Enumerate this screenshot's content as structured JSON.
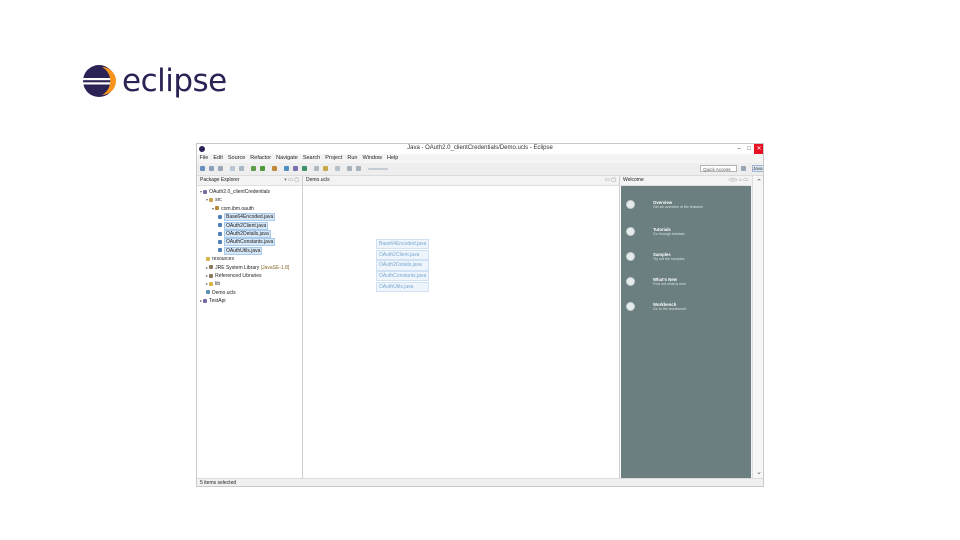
{
  "logo": {
    "text": "eclipse"
  },
  "window": {
    "title": "Java - OAuth2.0_clientCredentials/Demo.ucls - Eclipse",
    "controls": [
      "–",
      "□",
      "✕"
    ]
  },
  "menu": [
    "File",
    "Edit",
    "Source",
    "Refactor",
    "Navigate",
    "Search",
    "Project",
    "Run",
    "Window",
    "Help"
  ],
  "toolbar": {
    "quick_access": "Quick Access",
    "perspective": "Java"
  },
  "package_explorer": {
    "tab_label": "Package Explorer",
    "tree": [
      {
        "label": "OAuth2.0_clientCredentials",
        "level": 0,
        "icon": "project-icon"
      },
      {
        "label": "src",
        "level": 1,
        "icon": "source-folder-icon"
      },
      {
        "label": "com.ibm.oauth",
        "level": 2,
        "icon": "package-icon"
      },
      {
        "label": "Base64Encoded.java",
        "level": 3,
        "icon": "java-file-icon",
        "selected": true
      },
      {
        "label": "OAuth2Client.java",
        "level": 3,
        "icon": "java-file-icon",
        "selected": true
      },
      {
        "label": "OAuth2Details.java",
        "level": 3,
        "icon": "java-file-icon",
        "selected": true
      },
      {
        "label": "OAuthConstants.java",
        "level": 3,
        "icon": "java-file-icon",
        "selected": true
      },
      {
        "label": "OAuthUtils.java",
        "level": 3,
        "icon": "java-file-icon",
        "selected": true
      },
      {
        "label": "resources",
        "level": 1,
        "icon": "folder-icon"
      },
      {
        "label": "JRE System Library",
        "suffix": " [JavaSE-1.8]",
        "level": 1,
        "icon": "library-icon"
      },
      {
        "label": "Referenced Libraries",
        "level": 1,
        "icon": "library-icon"
      },
      {
        "label": "lib",
        "level": 1,
        "icon": "folder-icon"
      },
      {
        "label": "Demo.ucls",
        "level": 1,
        "icon": "ucls-file-icon"
      },
      {
        "label": "TestApi",
        "level": 0,
        "icon": "project-icon"
      }
    ]
  },
  "editor": {
    "tab_label": "Demo.ucls",
    "dragged_items": [
      "Base64Encoded.java",
      "OAuth2Client.java",
      "OAuth2Details.java",
      "OAuthConstants.java",
      "OAuthUtils.java"
    ]
  },
  "welcome": {
    "tab_label": "Welcome",
    "links": [
      {
        "title": "Overview",
        "desc": "Get an overview of the features",
        "icon": "overview-icon"
      },
      {
        "title": "Tutorials",
        "desc": "Go through tutorials",
        "icon": "tutorials-icon"
      },
      {
        "title": "Samples",
        "desc": "Try out the samples",
        "icon": "samples-icon"
      },
      {
        "title": "What's New",
        "desc": "Find out what is new",
        "icon": "whats-new-icon"
      },
      {
        "title": "Workbench",
        "desc": "Go to the workbench",
        "icon": "workbench-icon"
      }
    ]
  },
  "status": {
    "text": "5 items selected"
  },
  "colors": {
    "welcome_bg": "#6b7e80",
    "selection": "#d6e7f7",
    "brand": "#2c2255"
  }
}
